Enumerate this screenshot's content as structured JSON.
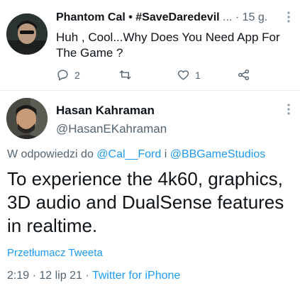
{
  "reply_tweet": {
    "display_name": "Phantom Cal • #SaveDaredevil",
    "handle_truncated": "...",
    "time": "15 g.",
    "text": "Huh , Cool...Why Does You Need App For The Game ?",
    "reply_count": "2",
    "like_count": "1",
    "more_icon": "ellipsis-vertical-icon"
  },
  "main_tweet": {
    "display_name": "Hasan Kahraman",
    "handle": "@HasanEKahraman",
    "replying_prefix": "W odpowiedzi do",
    "replying_user1": "@Cal__Ford",
    "replying_joiner": "i",
    "replying_user2": "@BBGameStudios",
    "text": "To experience the 4k60, graphics, 3D audio and DualSense features in realtime.",
    "translate_label": "Przetłumacz Tweeta",
    "time": "2:19",
    "date": "12 lip 21",
    "separator": "·",
    "client": "Twitter for iPhone"
  },
  "colors": {
    "accent": "#1d9bf0",
    "text": "#0f1419",
    "muted": "#536471"
  }
}
